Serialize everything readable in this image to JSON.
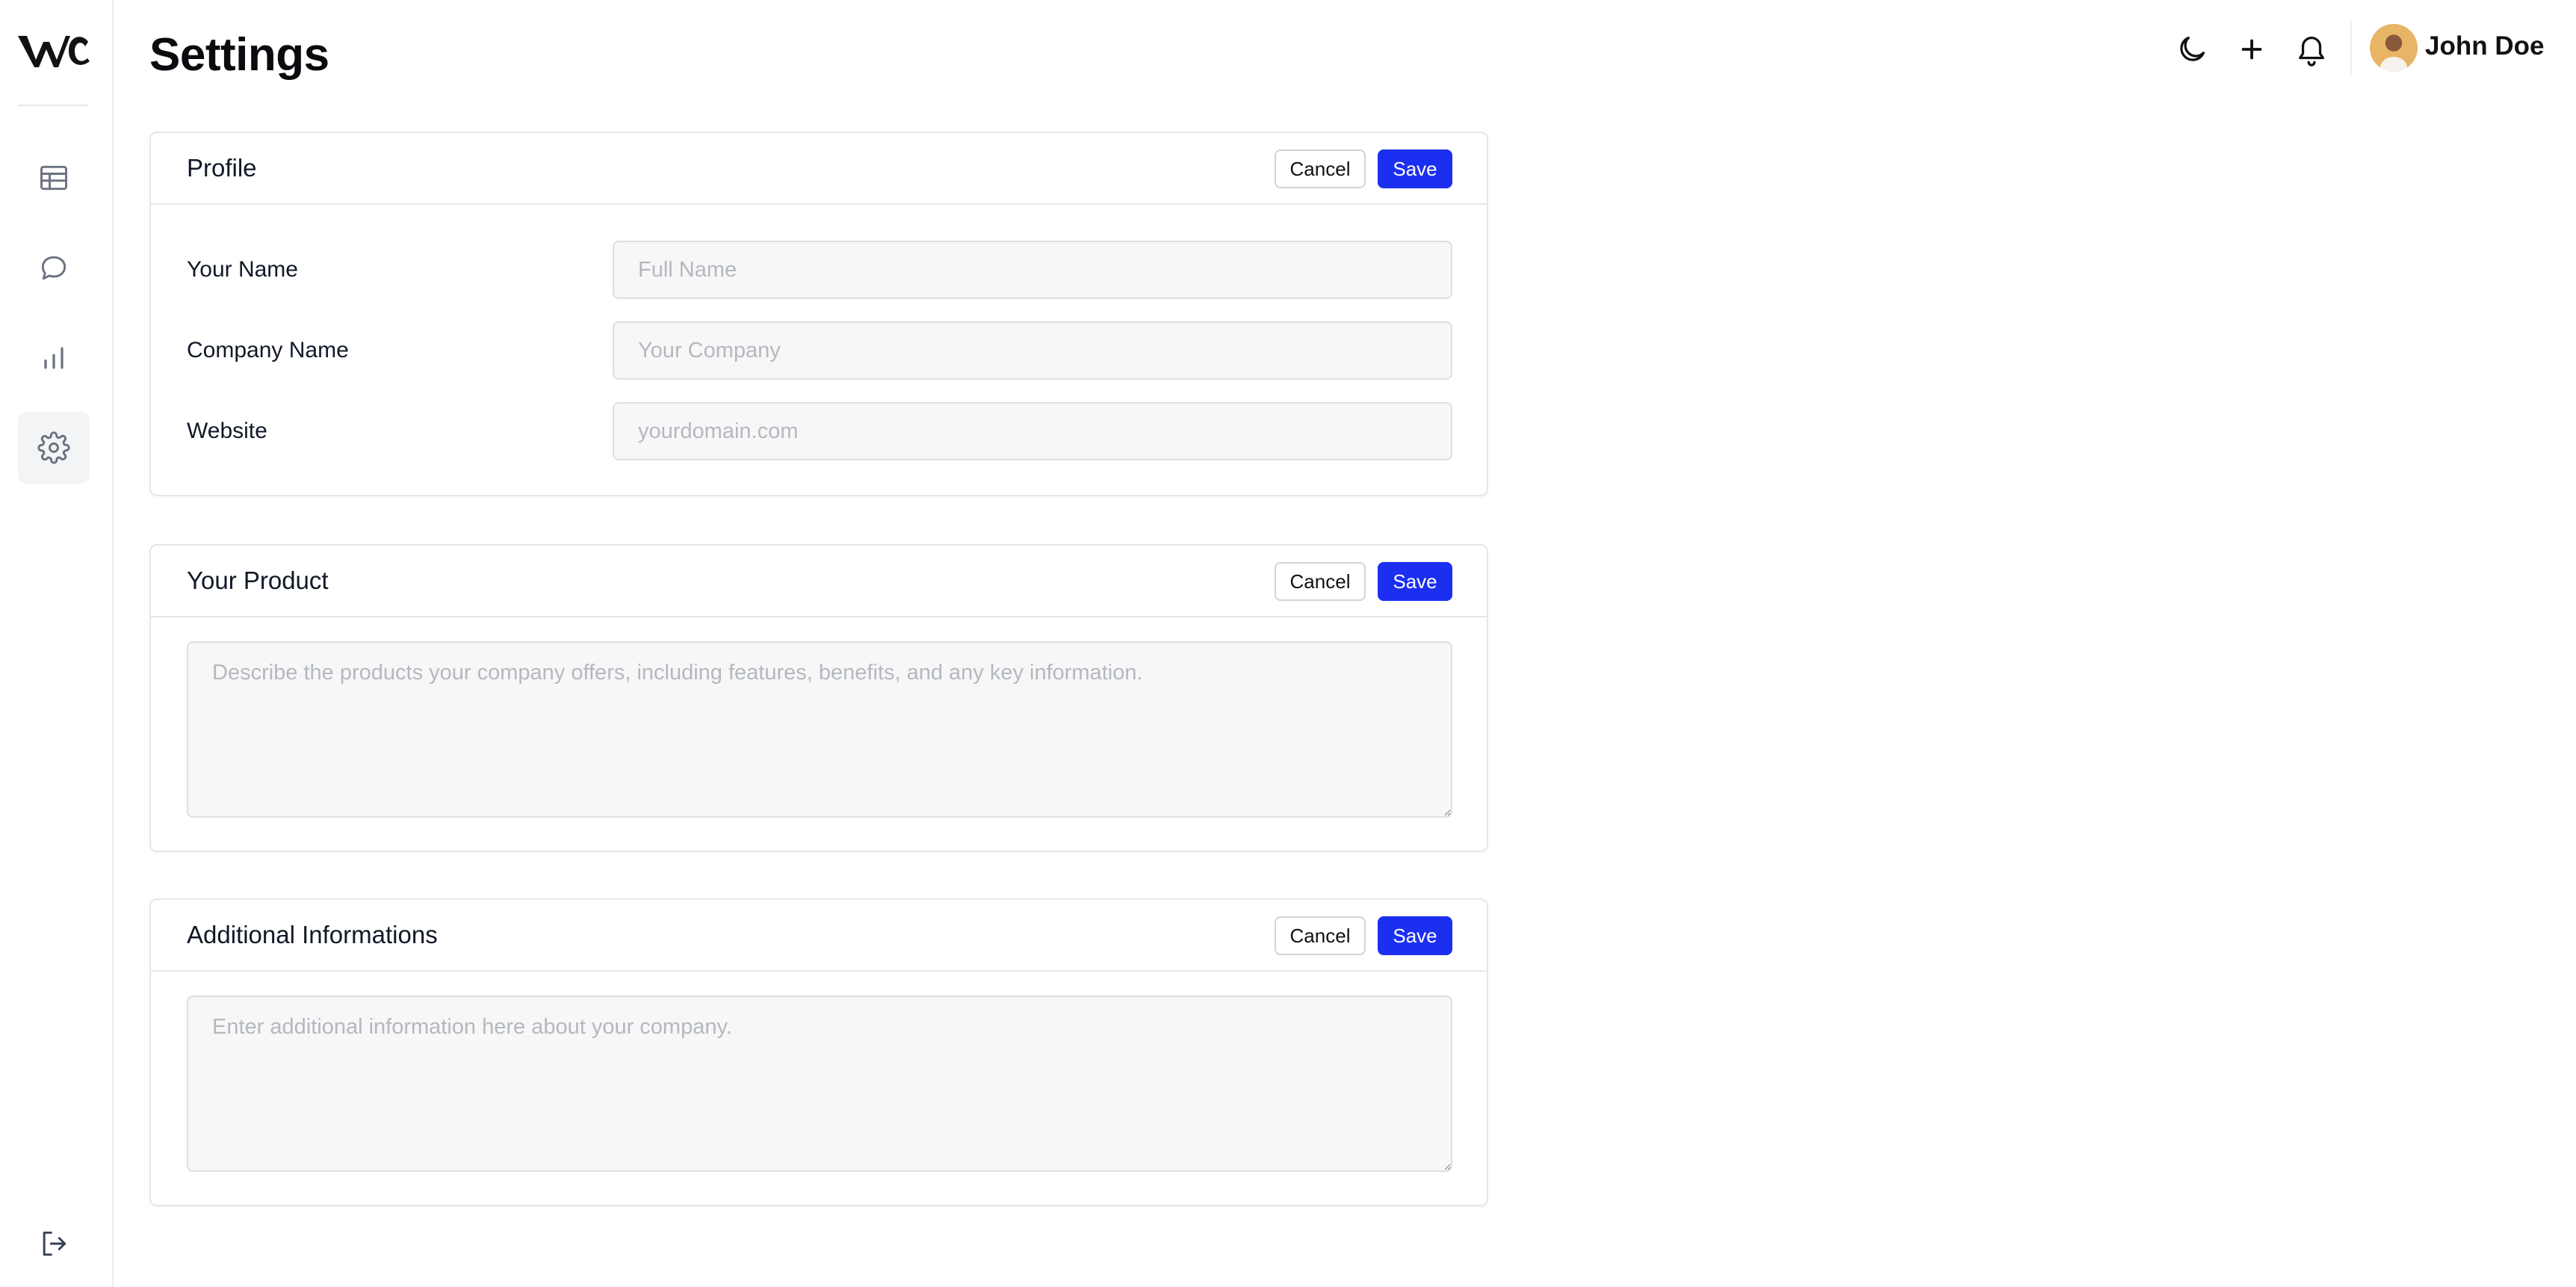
{
  "app": {
    "page_title": "Settings",
    "logo_text": "We"
  },
  "sidebar": {
    "items": [
      {
        "name": "table-icon",
        "active": false
      },
      {
        "name": "chat-bubble-icon",
        "active": false
      },
      {
        "name": "bar-chart-icon",
        "active": false
      },
      {
        "name": "gear-icon",
        "active": true
      }
    ],
    "footer_icon": "logout-icon"
  },
  "header": {
    "icons": [
      "moon-icon",
      "plus-icon",
      "bell-icon"
    ],
    "user_name": "John Doe"
  },
  "profile": {
    "title": "Profile",
    "cancel_label": "Cancel",
    "save_label": "Save",
    "fields": [
      {
        "label": "Your Name",
        "placeholder": "Full Name",
        "value": ""
      },
      {
        "label": "Company Name",
        "placeholder": "Your Company",
        "value": ""
      },
      {
        "label": "Website",
        "placeholder": "yourdomain.com",
        "value": ""
      }
    ]
  },
  "product": {
    "title": "Your Product",
    "cancel_label": "Cancel",
    "save_label": "Save",
    "placeholder": "Describe the products your company offers, including features, benefits, and any key information."
  },
  "additional": {
    "title": "Additional Informations",
    "cancel_label": "Cancel",
    "save_label": "Save",
    "placeholder": "Enter additional information here about your company."
  },
  "colors": {
    "accent": "#1c2ff0",
    "border": "#e5e7eb",
    "input_bg": "#f7f7f8",
    "placeholder": "#b4b8bf",
    "sidebar_active_bg": "#f3f4f6"
  }
}
